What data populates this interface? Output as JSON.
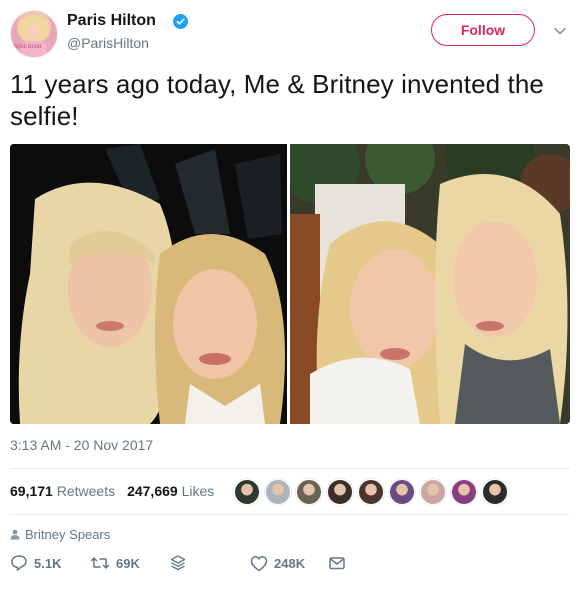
{
  "author": {
    "name": "Paris Hilton",
    "handle": "@ParisHilton",
    "avatar_caption": "ROSE RUSH"
  },
  "follow_label": "Follow",
  "tweet_text": "11 years ago today, Me & Britney invented the selfie!",
  "timestamp": "3:13 AM - 20 Nov 2017",
  "stats": {
    "retweets_count": "69,171",
    "retweets_label": "Retweets",
    "likes_count": "247,669",
    "likes_label": "Likes"
  },
  "liked_by_faces": [
    "#2f3a2f",
    "#aab4bd",
    "#6a6350",
    "#3d2f2a",
    "#4a3530",
    "#6b4a86",
    "#c9a7a6",
    "#8a3e83",
    "#2c2c2c"
  ],
  "reply_context": "Britney Spears",
  "actions": {
    "replies": "5.1K",
    "retweets": "69K",
    "likes": "248K"
  },
  "colors": {
    "follow_accent": "#e0245e",
    "verified": "#1da1f2",
    "muted_text": "#657786"
  }
}
